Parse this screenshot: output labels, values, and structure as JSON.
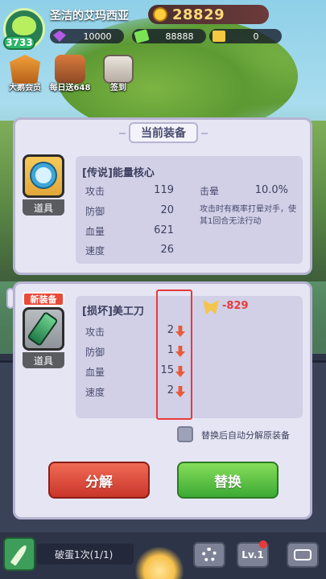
{
  "header": {
    "avatar_level": "3733",
    "player_name": "圣洁的艾玛西亚",
    "gold": "28829"
  },
  "resources": [
    {
      "icon": "gem-icon",
      "value": "10000"
    },
    {
      "icon": "cash-icon",
      "value": "88888"
    },
    {
      "icon": "ticket-icon",
      "value": "0"
    }
  ],
  "top_buttons": [
    {
      "icon": "vip-icon",
      "label": "大鹅会员"
    },
    {
      "icon": "daily-gift-icon",
      "label": "每日送648"
    },
    {
      "icon": "sign-in-icon",
      "label": "签到"
    }
  ],
  "current_equip": {
    "panel_title": "当前装备",
    "item_label": "道具",
    "name": "[传说]能量核心",
    "stats": [
      {
        "label": "攻击",
        "value": "119"
      },
      {
        "label": "防御",
        "value": "20"
      },
      {
        "label": "血量",
        "value": "621"
      },
      {
        "label": "速度",
        "value": "26"
      }
    ],
    "skill_label": "击晕",
    "skill_value": "10.0%",
    "skill_desc": "攻击时有概率打晕对手，使其1回合无法行动"
  },
  "new_equip": {
    "badge": "新装备",
    "item_label": "道具",
    "name": "[损坏]美工刀",
    "power_change": "-829",
    "stats": [
      {
        "label": "攻击",
        "value": "2"
      },
      {
        "label": "防御",
        "value": "1"
      },
      {
        "label": "血量",
        "value": "15"
      },
      {
        "label": "速度",
        "value": "2"
      }
    ],
    "auto_decompose_label": "替换后自动分解原装备",
    "decompose_button": "分解",
    "replace_button": "替换"
  },
  "bottom_bar": {
    "egg_progress": "破蛋1次(1/1)",
    "level_button": "Lv.1"
  }
}
